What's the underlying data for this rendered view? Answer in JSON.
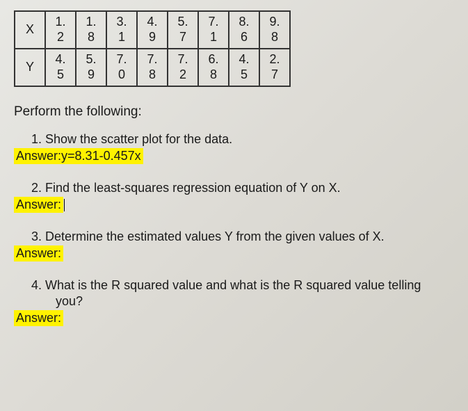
{
  "table": {
    "rows": [
      {
        "label": "X",
        "values": [
          "1.2",
          "1.8",
          "3.1",
          "4.9",
          "5.7",
          "7.1",
          "8.6",
          "9.8"
        ]
      },
      {
        "label": "Y",
        "values": [
          "4.5",
          "5.9",
          "7.0",
          "7.8",
          "7.2",
          "6.8",
          "4.5",
          "2.7"
        ]
      }
    ]
  },
  "instruction": "Perform the following:",
  "questions": [
    {
      "num": "1.",
      "text": "Show the scatter plot for the data.",
      "answer_prefix": "Answer:",
      "answer_value": "y=8.31-0.457x",
      "highlighted_answer": true,
      "cursor": false
    },
    {
      "num": "2.",
      "text": "Find the least-squares regression equation of Y on X.",
      "answer_prefix": "Answer:",
      "answer_value": "",
      "highlighted_answer": false,
      "cursor": true
    },
    {
      "num": "3.",
      "text": "Determine the estimated values Y from the given values of X.",
      "answer_prefix": "Answer:",
      "answer_value": "",
      "highlighted_answer": false,
      "cursor": false
    },
    {
      "num": "4.",
      "text": "What is the R squared value and what is the R squared value telling",
      "text2": "you?",
      "answer_prefix": "Answer:",
      "answer_value": "",
      "highlighted_answer": false,
      "cursor": false
    }
  ]
}
